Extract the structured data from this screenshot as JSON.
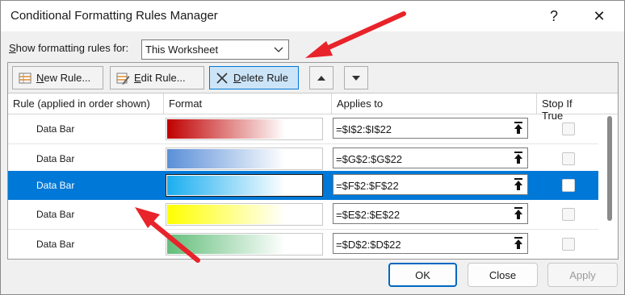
{
  "window": {
    "title": "Conditional Formatting Rules Manager",
    "help_glyph": "?",
    "close_glyph": "✕"
  },
  "filter": {
    "label_key": "S",
    "label_rest": "how formatting rules for:",
    "value": "This Worksheet"
  },
  "toolbar": {
    "new_key": "N",
    "new_rest": "ew Rule...",
    "edit_key": "E",
    "edit_rest": "dit Rule...",
    "delete_key": "D",
    "delete_rest": "elete Rule"
  },
  "columns": {
    "rule": "Rule (applied in order shown)",
    "format": "Format",
    "applies": "Applies to",
    "stop": "Stop If True"
  },
  "rules": [
    {
      "name": "Data Bar",
      "applies_to": "=$I$2:$I$22",
      "bar_color": "#c00000",
      "selected": false,
      "stop_if_true": false
    },
    {
      "name": "Data Bar",
      "applies_to": "=$G$2:$G$22",
      "bar_color": "#5b8fd8",
      "selected": false,
      "stop_if_true": false
    },
    {
      "name": "Data Bar",
      "applies_to": "=$F$2:$F$22",
      "bar_color": "#19aef0",
      "selected": true,
      "stop_if_true": false
    },
    {
      "name": "Data Bar",
      "applies_to": "=$E$2:$E$22",
      "bar_color": "#ffff00",
      "selected": false,
      "stop_if_true": false
    },
    {
      "name": "Data Bar",
      "applies_to": "=$D$2:$D$22",
      "bar_color": "#63be7b",
      "selected": false,
      "stop_if_true": false
    }
  ],
  "buttons": {
    "ok": "OK",
    "close": "Close",
    "apply": "Apply"
  },
  "colors": {
    "accent": "#0078d7",
    "annotation_arrow": "#e8232a"
  }
}
